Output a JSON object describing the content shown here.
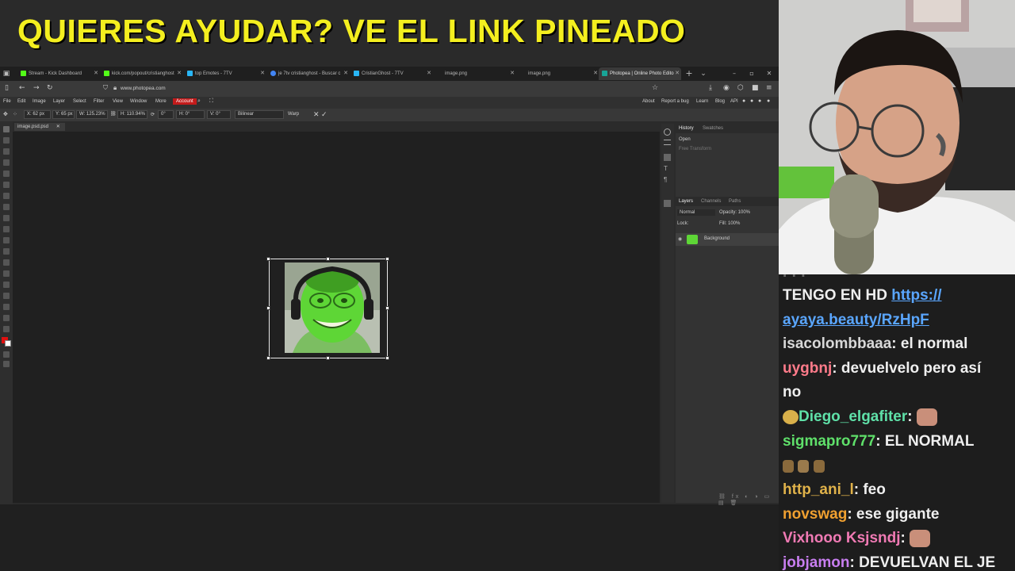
{
  "banner": {
    "text": "QUIERES AYUDAR? VE EL LINK PINEADO"
  },
  "browser": {
    "tabs": [
      {
        "title": "Stream - Kick Dashboard",
        "color": "#53fc18"
      },
      {
        "title": "kick.com/popout/cristianghost",
        "color": "#53fc18"
      },
      {
        "title": "top Emotes - 7TV",
        "color": "#29b6f6"
      },
      {
        "title": "je 7tv cristianghost - Buscar c",
        "color": "#4285f4"
      },
      {
        "title": "CristianGhost - 7TV",
        "color": "#29b6f6"
      },
      {
        "title": "image.png",
        "color": "#888888"
      },
      {
        "title": "image.png",
        "color": "#888888"
      },
      {
        "title": "Photopea | Online Photo Edito",
        "color": "#18a497"
      }
    ],
    "url": "www.photopea.com"
  },
  "photopea": {
    "menu": [
      "File",
      "Edit",
      "Image",
      "Layer",
      "Select",
      "Filter",
      "View",
      "Window",
      "More"
    ],
    "account": "Account",
    "right_links": [
      "About",
      "Report a bug",
      "Learn",
      "Blog",
      "API"
    ],
    "options": {
      "x": "X: 62 px",
      "y": "Y: 65 px",
      "w": "W: 125.23%",
      "h": "H: 110.94%",
      "rot": "0°",
      "skew_h": "H: 0°",
      "skew_v": "V: 0°",
      "interp": "Bilinear",
      "warp": "Warp"
    },
    "doc_tab": "image.psd.psd",
    "history": {
      "tabs": [
        "History",
        "Swatches"
      ],
      "items": [
        "Open",
        "Free Transform"
      ]
    },
    "layers": {
      "tabs": [
        "Layers",
        "Channels",
        "Paths"
      ],
      "blend": "Normal",
      "opacity": "Opacity: 100%",
      "lock": "Lock:",
      "fill": "Fill: 100%",
      "layer_name": "Background"
    }
  },
  "chat": [
    {
      "user": "",
      "text": "TENGO EN HD ",
      "link": "https://",
      "color": "#efefef"
    },
    {
      "user": "",
      "text": "",
      "link": "ayaya.beauty/RzHpF",
      "color": "#efefef"
    },
    {
      "user": "isacolombbaaa",
      "text": "el normal",
      "color": "#d8d8d8"
    },
    {
      "user": "uygbnj",
      "text": "devuelvelo pero así",
      "color": "#ff7b8a"
    },
    {
      "user": "",
      "text": "no",
      "color": "#efefef"
    },
    {
      "user": "Diego_elgafiter",
      "text": "",
      "color": "#5fe0a8"
    },
    {
      "user": "sigmapro777",
      "text": "EL NORMAL",
      "color": "#5fe06a"
    },
    {
      "user": "http_ani_l",
      "text": "feo",
      "color": "#e0b24a"
    },
    {
      "user": "novswag",
      "text": "ese gigante",
      "color": "#f0a030"
    },
    {
      "user": "Vixhooo Ksjsndj",
      "text": "",
      "color": "#f07ab4"
    },
    {
      "user": "jobjamon",
      "text": "DEVUELVAN EL JE",
      "color": "#c87ef0"
    }
  ]
}
